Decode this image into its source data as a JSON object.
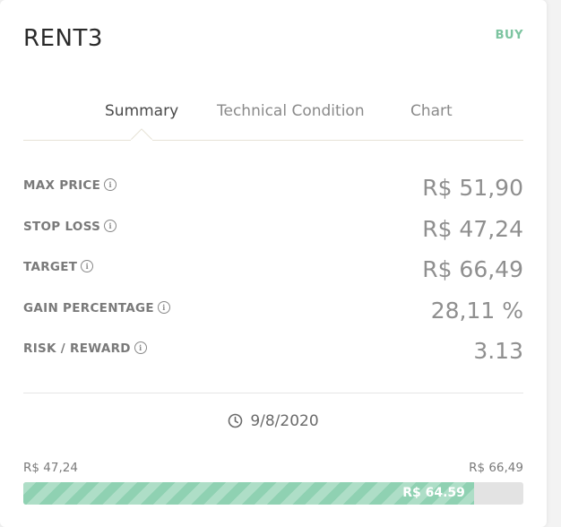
{
  "ticker": "RENT3",
  "buy_label": "BUY",
  "tabs": [
    {
      "label": "Summary",
      "active": true
    },
    {
      "label": "Technical Condition",
      "active": false
    },
    {
      "label": "Chart",
      "active": false
    }
  ],
  "metrics": [
    {
      "label": "MAX PRICE",
      "value": "R$ 51,90"
    },
    {
      "label": "STOP LOSS",
      "value": "R$ 47,24"
    },
    {
      "label": "TARGET",
      "value": "R$ 66,49"
    },
    {
      "label": "GAIN PERCENTAGE",
      "value": "28,11 %"
    },
    {
      "label": "RISK / REWARD",
      "value": "3.13"
    }
  ],
  "info_glyph": "i",
  "date": "9/8/2020",
  "range": {
    "min_label": "R$ 47,24",
    "max_label": "R$ 66,49",
    "current_label": "R$ 64.59",
    "min": 47.24,
    "max": 66.49,
    "current": 64.59
  },
  "colors": {
    "accent": "#7cc4a0",
    "bar_fill": "#8fd1b2",
    "bar_track": "#e3e3e3"
  }
}
